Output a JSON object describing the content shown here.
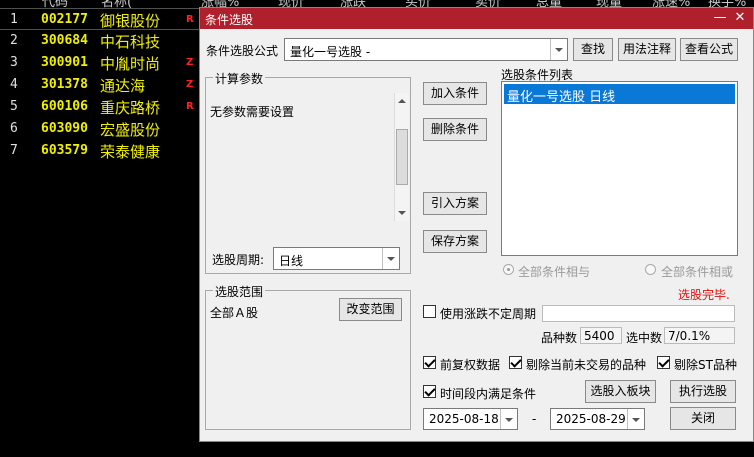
{
  "header": {
    "columns": [
      "代码",
      "名称(",
      "涨幅%",
      "现价",
      "涨跌",
      "买价",
      "卖价",
      "总量",
      "现量",
      "涨速%",
      "换手%"
    ]
  },
  "stocks": [
    {
      "idx": "1",
      "code": "002177",
      "name": "御银股份",
      "mark": "R"
    },
    {
      "idx": "2",
      "code": "300684",
      "name": "中石科技",
      "mark": ""
    },
    {
      "idx": "3",
      "code": "300901",
      "name": "中胤时尚",
      "mark": "Z"
    },
    {
      "idx": "4",
      "code": "301378",
      "name": "通达海",
      "mark": "Z"
    },
    {
      "idx": "5",
      "code": "600106",
      "name": "重庆路桥",
      "mark": "R"
    },
    {
      "idx": "6",
      "code": "603090",
      "name": "宏盛股份",
      "mark": ""
    },
    {
      "idx": "7",
      "code": "603579",
      "name": "荣泰健康",
      "mark": ""
    }
  ],
  "dialog": {
    "title": "条件选股",
    "minimize": "—",
    "close": "✕",
    "formula_label": "条件选股公式",
    "formula_value": "量化一号选股 -",
    "find_button": "查找",
    "usage_button": "用法注释",
    "view_button": "查看公式",
    "params_title": "计算参数",
    "params_text": "无参数需要设置",
    "period_label": "选股周期:",
    "period_value": "日线",
    "add_condition": "加入条件",
    "delete_condition": "删除条件",
    "import_plan": "引入方案",
    "save_plan": "保存方案",
    "condition_list_title": "选股条件列表",
    "condition_item": "量化一号选股  日线",
    "radio_and": "全部条件相与",
    "radio_or": "全部条件相或",
    "status": "选股完毕.",
    "range_title": "选股范围",
    "range_value": "全部Ａ股",
    "change_range": "改变范围",
    "use_uncertain_period": "使用涨跌不定周期",
    "variety_count_label": "品种数",
    "variety_count": "5400",
    "selected_label": "选中数",
    "selected_value": "7/0.1%",
    "pre_adjust": "前复权数据",
    "exclude_untraded": "剔除当前未交易的品种",
    "exclude_st": "剔除ST品种",
    "time_range": "时间段内满足条件",
    "to_block": "选股入板块",
    "execute": "执行选股",
    "date_start": "2025-08-18",
    "date_sep": "-",
    "date_end": "2025-08-29",
    "close_button": "关闭"
  },
  "colors": {
    "title_bar": "#b0202c",
    "stock_text": "#f0f000",
    "status_text": "#e01010",
    "selection": "#0a78d7"
  }
}
